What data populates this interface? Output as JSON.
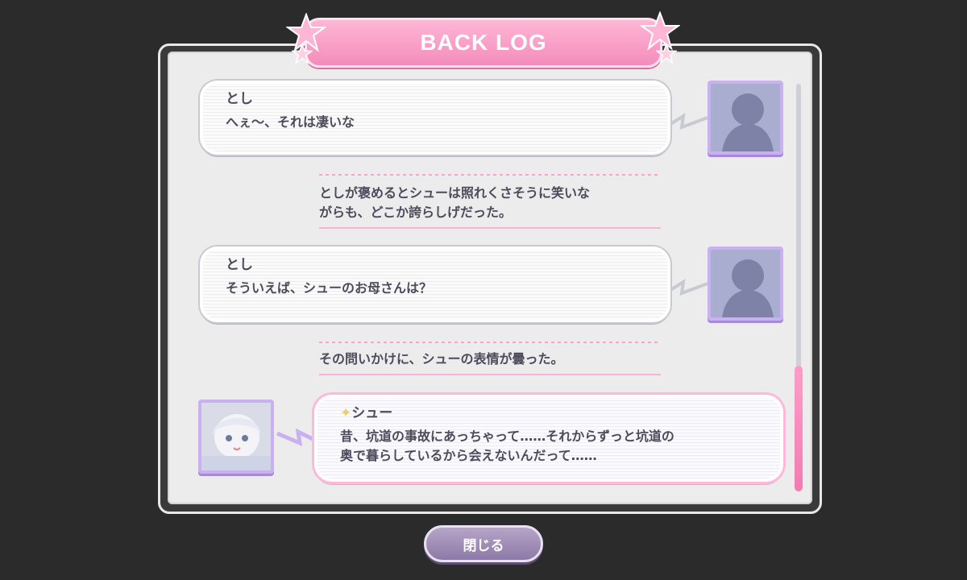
{
  "header": {
    "title": "BACK LOG"
  },
  "log": [
    {
      "type": "dialogue",
      "speaker": "とし",
      "lines": [
        "へぇ～、それは凄いな"
      ],
      "avatar": "silhouette-avatar"
    },
    {
      "type": "narration",
      "lines": [
        "としが褒めるとシューは照れくさそうに笑いな",
        "がらも、どこか誇らしげだった。"
      ]
    },
    {
      "type": "dialogue",
      "speaker": "とし",
      "lines": [
        "そういえば、シューのお母さんは？"
      ],
      "avatar": "silhouette-avatar"
    },
    {
      "type": "narration",
      "lines": [
        "その問いかけに、シューの表情が曇った。"
      ]
    },
    {
      "type": "dialogue",
      "speaker": "シュー",
      "lines": [
        "昔、坑道の事故にあっちゃって……それからずっと坑道の",
        "奥で暮らしているから会えないんだって……"
      ],
      "avatar": "heroine-portrait"
    }
  ],
  "footer": {
    "close_label": "閉じる"
  },
  "colors": {
    "accent_pink": "#f48cbb",
    "accent_purple": "#c9b0ef",
    "background": "#2b2b2b",
    "panel": "#ececec"
  }
}
